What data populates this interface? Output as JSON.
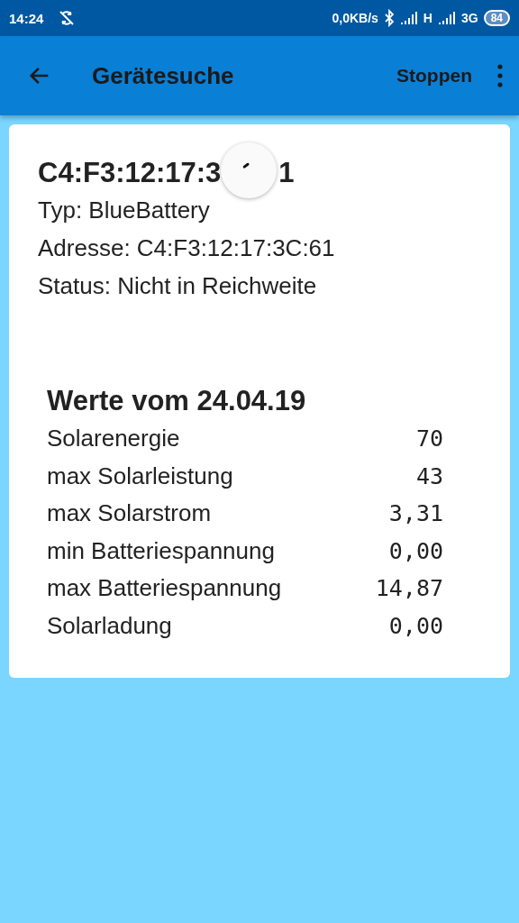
{
  "status_bar": {
    "time": "14:24",
    "speed": "0,0KB/s",
    "network_1": "H",
    "network_2": "3G",
    "battery": "84"
  },
  "app_bar": {
    "title": "Gerätesuche",
    "action": "Stoppen"
  },
  "device": {
    "heading_parts": [
      "C4:F3:12:17:3",
      "1"
    ],
    "loading": true,
    "lines": [
      "Typ: BlueBattery",
      "Adresse: C4:F3:12:17:3C:61",
      "Status: Nicht in Reichweite"
    ]
  },
  "values": {
    "title": "Werte vom 24.04.19",
    "rows": [
      {
        "label": "Solarenergie",
        "value": "70"
      },
      {
        "label": "max Solarleistung",
        "value": "43"
      },
      {
        "label": "max Solarstrom",
        "value": "3,31"
      },
      {
        "label": "min Batteriespannung",
        "value": "0,00"
      },
      {
        "label": "max Batteriespannung",
        "value": "14,87"
      },
      {
        "label": "Solarladung",
        "value": "0,00"
      }
    ]
  }
}
